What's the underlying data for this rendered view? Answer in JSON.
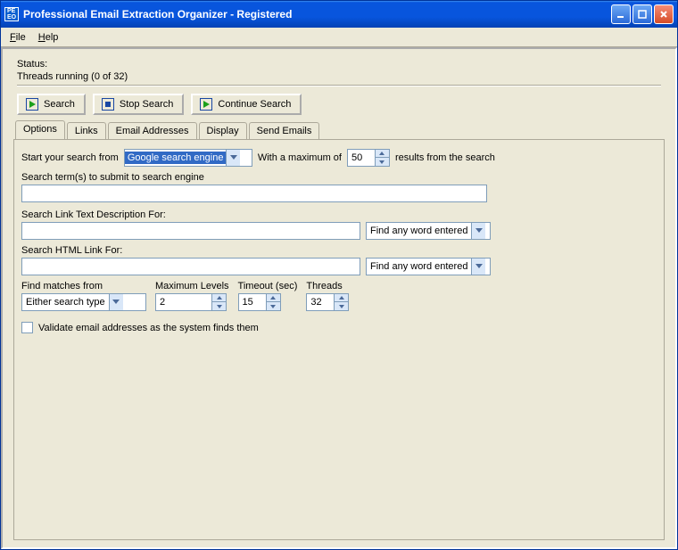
{
  "title": "Professional Email Extraction Organizer - Registered",
  "menu": {
    "file": "File",
    "help": "Help"
  },
  "status": {
    "label": "Status:",
    "threads": "Threads running (0 of 32)"
  },
  "toolbar": {
    "search": "Search",
    "stop": "Stop Search",
    "cont": "Continue Search"
  },
  "tabs": [
    "Options",
    "Links",
    "Email Addresses",
    "Display",
    "Send Emails"
  ],
  "opt": {
    "start_label": "Start your search from",
    "start_value": "Google search engine",
    "max_label": "With a maximum of",
    "max_value": "50",
    "max_suffix": "results from the search",
    "term_label": "Search term(s) to submit to search engine",
    "link_desc_label": "Search Link Text Description For:",
    "link_desc_mode": "Find any word entered",
    "html_link_label": "Search HTML Link For:",
    "html_link_mode": "Find any word entered",
    "find_from_label": "Find matches from",
    "find_from_value": "Either search type",
    "maxlev_label": "Maximum Levels",
    "maxlev_value": "2",
    "timeout_label": "Timeout (sec)",
    "timeout_value": "15",
    "threads_label": "Threads",
    "threads_value": "32",
    "validate_label": "Validate email addresses as the system finds them"
  }
}
